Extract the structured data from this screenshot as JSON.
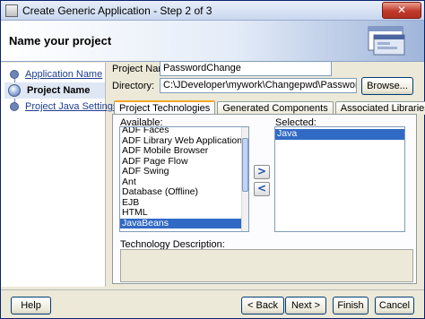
{
  "window": {
    "title": "Create Generic Application - Step 2 of 3",
    "close_glyph": "✕"
  },
  "header": {
    "title": "Name your project",
    "graphic_icon": "wizard-windows-icon"
  },
  "nav": {
    "items": [
      {
        "label": "Application Name"
      },
      {
        "label": "Project Name"
      },
      {
        "label": "Project Java Settings"
      }
    ]
  },
  "form": {
    "project_name_label": "Project Name:",
    "project_name_value": "PasswordChange",
    "directory_label": "Directory:",
    "directory_value": "C:\\JDeveloper\\mywork\\Changepwd\\PasswordChange",
    "browse_label": "Browse..."
  },
  "tabs": [
    "Project Technologies",
    "Generated Components",
    "Associated Libraries"
  ],
  "technologies": {
    "available_label": "Available:",
    "available_items": [
      "ADF Faces",
      "ADF Library Web Application Support",
      "ADF Mobile Browser",
      "ADF Page Flow",
      "ADF Swing",
      "Ant",
      "Database (Offline)",
      "EJB",
      "HTML",
      "JavaBeans"
    ],
    "selected_available": "JavaBeans",
    "selected_label": "Selected:",
    "selected_items": [
      "Java"
    ],
    "add_glyph": ">",
    "remove_glyph": "<",
    "description_label": "Technology Description:"
  },
  "footer": {
    "help": "Help",
    "back": "< Back",
    "next": "Next >",
    "finish": "Finish",
    "cancel": "Cancel"
  },
  "colors": {
    "accent": "#316ac5",
    "tab_highlight": "#f5a623"
  }
}
